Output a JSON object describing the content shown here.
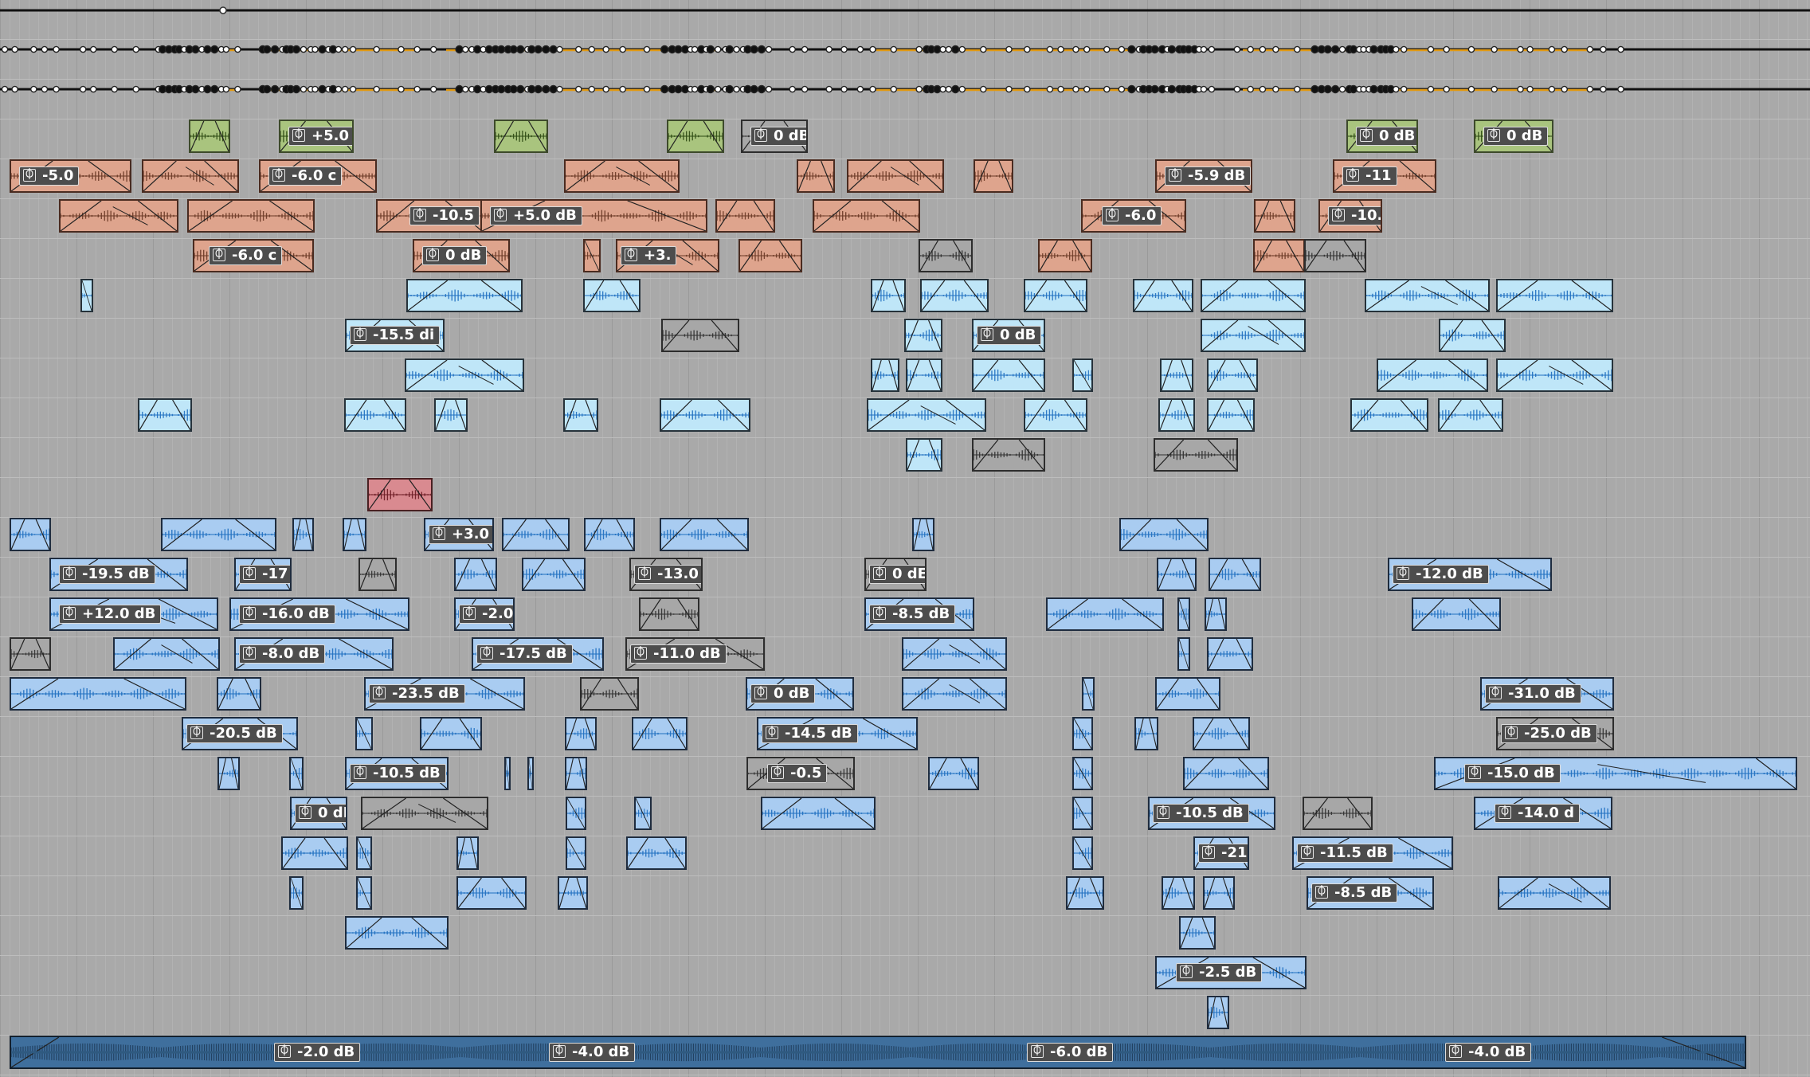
{
  "colors": {
    "background": "#a9a9a9",
    "automation_line": "#111111",
    "automation_highlight": "#e19a14",
    "green_clip": "#a9c47e",
    "orange_clip": "#dea48d",
    "light_blue_clip": "#bfe6f8",
    "blue_clip": "#a9ccf1",
    "master_clip": "#3f6f9d"
  },
  "automation": {
    "lanes": 3
  },
  "clip_gains": {
    "green": [
      "+5.0 d",
      "0 dB",
      "0 dB",
      "0 dB"
    ],
    "orange_row2": [
      "-5.0",
      "-6.0 c",
      "-5.9 dB",
      "-11"
    ],
    "orange_row3": [
      "-10.5",
      "+5.0 dB",
      "-6.0",
      "-10."
    ],
    "orange_row4": [
      "-6.0 c",
      "0 dB",
      "+3."
    ],
    "light_row6": [
      "-15.5 di",
      "0 dB"
    ],
    "blue_row11": [
      "+3.0"
    ],
    "blue_row12": [
      "-19.5 dB",
      "-17",
      "-13.0",
      "0 dE",
      "-12.0 dB"
    ],
    "blue_row13": [
      "+12.0 dB",
      "-16.0 dB",
      "-2.0",
      "-8.5 dB"
    ],
    "blue_row14": [
      "-8.0 dB",
      "-17.5 dB",
      "-11.0 dB"
    ],
    "blue_row15": [
      "-23.5 dB",
      "0 dB",
      "-31.0 dB"
    ],
    "blue_row16": [
      "-20.5 dB",
      "-14.5 dB",
      "-25.0 dB"
    ],
    "blue_row17": [
      "-10.5 dB",
      "-0.5",
      "-15.0 dB"
    ],
    "blue_row18": [
      "0 dE",
      "-10.5 dB",
      "-14.0 d"
    ],
    "blue_row19": [
      "-21",
      "-11.5 dB"
    ],
    "blue_row20": [
      "-8.5 dB"
    ],
    "blue_row22": [
      "-2.5 dB"
    ],
    "master": [
      "-2.0 dB",
      "-4.0 dB",
      "-6.0 dB",
      "-4.0 dB"
    ]
  }
}
